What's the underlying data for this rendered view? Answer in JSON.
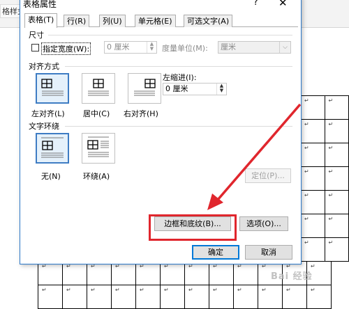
{
  "background": {
    "ribbon_label": "格样式",
    "cell_mark": "↵"
  },
  "dialog": {
    "title": "表格属性",
    "help_icon": "?",
    "close_icon": "✕",
    "tabs": [
      {
        "label": "表格(T)",
        "active": true
      },
      {
        "label": "行(R)",
        "active": false
      },
      {
        "label": "列(U)",
        "active": false
      },
      {
        "label": "单元格(E)",
        "active": false
      },
      {
        "label": "可选文字(A)",
        "active": false
      }
    ],
    "size": {
      "section_label": "尺寸",
      "preferred_width_label": "指定宽度(W):",
      "preferred_width_checked": false,
      "width_value": "0 厘米",
      "measure_label": "度量单位(M):",
      "measure_value": "厘米"
    },
    "alignment": {
      "section_label": "对齐方式",
      "options": [
        {
          "label": "左对齐(L)",
          "icon": "align-left-icon",
          "selected": true
        },
        {
          "label": "居中(C)",
          "icon": "align-center-icon",
          "selected": false
        },
        {
          "label": "右对齐(H)",
          "icon": "align-right-icon",
          "selected": false
        }
      ],
      "indent_label": "左缩进(I):",
      "indent_value": "0 厘米"
    },
    "wrapping": {
      "section_label": "文字环绕",
      "options": [
        {
          "label": "无(N)",
          "icon": "wrap-none-icon",
          "selected": true
        },
        {
          "label": "环绕(A)",
          "icon": "wrap-around-icon",
          "selected": false
        }
      ],
      "positioning_button": "定位(P)..."
    },
    "buttons": {
      "borders_shading": "边框和底纹(B)...",
      "options": "选项(O)...",
      "ok": "确定",
      "cancel": "取消"
    }
  },
  "annotation": {
    "highlight_color": "#e0262d",
    "arrow_color": "#e0262d"
  },
  "watermark": "Bai 经验"
}
